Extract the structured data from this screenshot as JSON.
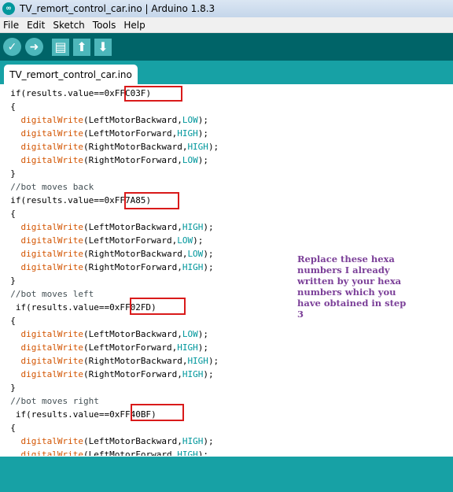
{
  "window": {
    "title": "TV_remort_control_car.ino | Arduino 1.8.3",
    "logo_text": "∞"
  },
  "menu": [
    "File",
    "Edit",
    "Sketch",
    "Tools",
    "Help"
  ],
  "toolbar": {
    "buttons": [
      "verify-icon",
      "upload-icon",
      "new-icon",
      "open-icon",
      "save-icon"
    ],
    "glyphs": {
      "verify": "✓",
      "upload": "➜",
      "new": "▤",
      "open": "⬆",
      "save": "⬇"
    }
  },
  "tab": {
    "label": "TV_remort_control_car.ino"
  },
  "code": {
    "lines": [
      [
        {
          "t": "  if(results.value==",
          "c": ""
        },
        {
          "t": "0xFFC03F",
          "c": "hex"
        },
        {
          "t": ")",
          "c": ""
        }
      ],
      [
        {
          "t": "  {",
          "c": ""
        }
      ],
      [
        {
          "t": "    ",
          "c": ""
        },
        {
          "t": "digitalWrite",
          "c": "fn"
        },
        {
          "t": "(LeftMotorBackward,",
          "c": ""
        },
        {
          "t": "LOW",
          "c": "kw"
        },
        {
          "t": ");",
          "c": ""
        }
      ],
      [
        {
          "t": "    ",
          "c": ""
        },
        {
          "t": "digitalWrite",
          "c": "fn"
        },
        {
          "t": "(LeftMotorForward,",
          "c": ""
        },
        {
          "t": "HIGH",
          "c": "kw"
        },
        {
          "t": ");",
          "c": ""
        }
      ],
      [
        {
          "t": "    ",
          "c": ""
        },
        {
          "t": "digitalWrite",
          "c": "fn"
        },
        {
          "t": "(RightMotorBackward,",
          "c": ""
        },
        {
          "t": "HIGH",
          "c": "kw"
        },
        {
          "t": ");",
          "c": ""
        }
      ],
      [
        {
          "t": "    ",
          "c": ""
        },
        {
          "t": "digitalWrite",
          "c": "fn"
        },
        {
          "t": "(RightMotorForward,",
          "c": ""
        },
        {
          "t": "LOW",
          "c": "kw"
        },
        {
          "t": ");",
          "c": ""
        }
      ],
      [
        {
          "t": "  }",
          "c": ""
        }
      ],
      [
        {
          "t": "  //bot moves back",
          "c": "cm"
        }
      ],
      [
        {
          "t": "  if(results.value==",
          "c": ""
        },
        {
          "t": "0xFF7A85",
          "c": "hex"
        },
        {
          "t": ")",
          "c": ""
        }
      ],
      [
        {
          "t": "  {",
          "c": ""
        }
      ],
      [
        {
          "t": "    ",
          "c": ""
        },
        {
          "t": "digitalWrite",
          "c": "fn"
        },
        {
          "t": "(LeftMotorBackward,",
          "c": ""
        },
        {
          "t": "HIGH",
          "c": "kw"
        },
        {
          "t": ");",
          "c": ""
        }
      ],
      [
        {
          "t": "    ",
          "c": ""
        },
        {
          "t": "digitalWrite",
          "c": "fn"
        },
        {
          "t": "(LeftMotorForward,",
          "c": ""
        },
        {
          "t": "LOW",
          "c": "kw"
        },
        {
          "t": ");",
          "c": ""
        }
      ],
      [
        {
          "t": "    ",
          "c": ""
        },
        {
          "t": "digitalWrite",
          "c": "fn"
        },
        {
          "t": "(RightMotorBackward,",
          "c": ""
        },
        {
          "t": "LOW",
          "c": "kw"
        },
        {
          "t": ");",
          "c": ""
        }
      ],
      [
        {
          "t": "    ",
          "c": ""
        },
        {
          "t": "digitalWrite",
          "c": "fn"
        },
        {
          "t": "(RightMotorForward,",
          "c": ""
        },
        {
          "t": "HIGH",
          "c": "kw"
        },
        {
          "t": ");",
          "c": ""
        }
      ],
      [
        {
          "t": "  }",
          "c": ""
        }
      ],
      [
        {
          "t": "  //bot moves left",
          "c": "cm"
        }
      ],
      [
        {
          "t": "   if(results.value==",
          "c": ""
        },
        {
          "t": "0xFF02FD",
          "c": "hex"
        },
        {
          "t": ")",
          "c": ""
        }
      ],
      [
        {
          "t": "  {",
          "c": ""
        }
      ],
      [
        {
          "t": "    ",
          "c": ""
        },
        {
          "t": "digitalWrite",
          "c": "fn"
        },
        {
          "t": "(LeftMotorBackward,",
          "c": ""
        },
        {
          "t": "LOW",
          "c": "kw"
        },
        {
          "t": ");",
          "c": ""
        }
      ],
      [
        {
          "t": "    ",
          "c": ""
        },
        {
          "t": "digitalWrite",
          "c": "fn"
        },
        {
          "t": "(LeftMotorForward,",
          "c": ""
        },
        {
          "t": "HIGH",
          "c": "kw"
        },
        {
          "t": ");",
          "c": ""
        }
      ],
      [
        {
          "t": "    ",
          "c": ""
        },
        {
          "t": "digitalWrite",
          "c": "fn"
        },
        {
          "t": "(RightMotorBackward,",
          "c": ""
        },
        {
          "t": "HIGH",
          "c": "kw"
        },
        {
          "t": ");",
          "c": ""
        }
      ],
      [
        {
          "t": "    ",
          "c": ""
        },
        {
          "t": "digitalWrite",
          "c": "fn"
        },
        {
          "t": "(RightMotorForward,",
          "c": ""
        },
        {
          "t": "HIGH",
          "c": "kw"
        },
        {
          "t": ");",
          "c": ""
        }
      ],
      [
        {
          "t": "  }",
          "c": ""
        }
      ],
      [
        {
          "t": "  //bot moves right",
          "c": "cm"
        }
      ],
      [
        {
          "t": "   if(results.value==",
          "c": ""
        },
        {
          "t": "0xFF40BF",
          "c": "hex"
        },
        {
          "t": ")",
          "c": ""
        }
      ],
      [
        {
          "t": "  {",
          "c": ""
        }
      ],
      [
        {
          "t": "    ",
          "c": ""
        },
        {
          "t": "digitalWrite",
          "c": "fn"
        },
        {
          "t": "(LeftMotorBackward,",
          "c": ""
        },
        {
          "t": "HIGH",
          "c": "kw"
        },
        {
          "t": ");",
          "c": ""
        }
      ],
      [
        {
          "t": "    ",
          "c": ""
        },
        {
          "t": "digitalWrite",
          "c": "fn"
        },
        {
          "t": "(LeftMotorForward,",
          "c": ""
        },
        {
          "t": "HIGH",
          "c": "kw"
        },
        {
          "t": ");",
          "c": ""
        }
      ]
    ]
  },
  "annotation": {
    "note": "Replace these hexa numbers I already written by your hexa numbers which you have obtained in step 3"
  },
  "colors": {
    "toolbar": "#006468",
    "tabstrip": "#17a1a5",
    "highlight_box": "#d91a1a",
    "note_text": "#7b3f98"
  }
}
